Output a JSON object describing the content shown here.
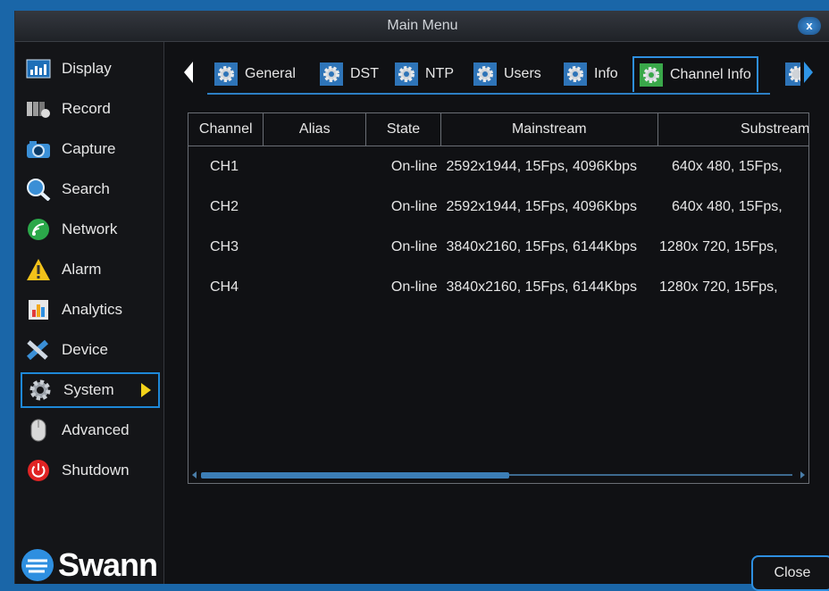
{
  "window": {
    "title": "Main Menu",
    "close_glyph": "x"
  },
  "sidebar": {
    "items": [
      {
        "label": "Display",
        "icon": "display-icon"
      },
      {
        "label": "Record",
        "icon": "record-icon"
      },
      {
        "label": "Capture",
        "icon": "camera-icon"
      },
      {
        "label": "Search",
        "icon": "search-icon"
      },
      {
        "label": "Network",
        "icon": "network-icon"
      },
      {
        "label": "Alarm",
        "icon": "alarm-icon"
      },
      {
        "label": "Analytics",
        "icon": "analytics-icon"
      },
      {
        "label": "Device",
        "icon": "device-icon"
      },
      {
        "label": "System",
        "icon": "gear-icon",
        "active": true
      },
      {
        "label": "Advanced",
        "icon": "mouse-icon"
      },
      {
        "label": "Shutdown",
        "icon": "power-icon"
      }
    ],
    "logo_text": "Swann"
  },
  "tabs": [
    {
      "label": "General"
    },
    {
      "label": "DST"
    },
    {
      "label": "NTP"
    },
    {
      "label": "Users"
    },
    {
      "label": "Info"
    },
    {
      "label": "Channel Info",
      "active": true
    }
  ],
  "table": {
    "columns": [
      "Channel",
      "Alias",
      "State",
      "Mainstream",
      "Substream"
    ],
    "rows": [
      {
        "channel": "CH1",
        "alias": "",
        "state": "On-line",
        "mainstream": "2592x1944, 15Fps,  4096Kbps",
        "substream": "640x 480, 15Fps,"
      },
      {
        "channel": "CH2",
        "alias": "",
        "state": "On-line",
        "mainstream": "2592x1944, 15Fps,  4096Kbps",
        "substream": "640x 480, 15Fps,"
      },
      {
        "channel": "CH3",
        "alias": "",
        "state": "On-line",
        "mainstream": "3840x2160, 15Fps,  6144Kbps",
        "substream": "1280x 720, 15Fps,"
      },
      {
        "channel": "CH4",
        "alias": "",
        "state": "On-line",
        "mainstream": "3840x2160, 15Fps,  6144Kbps",
        "substream": "1280x 720, 15Fps,"
      }
    ]
  },
  "footer": {
    "close_label": "Close"
  },
  "colors": {
    "background": "#1a66a8",
    "accent": "#2e8fe0",
    "active_arrow": "#f2d21a"
  }
}
